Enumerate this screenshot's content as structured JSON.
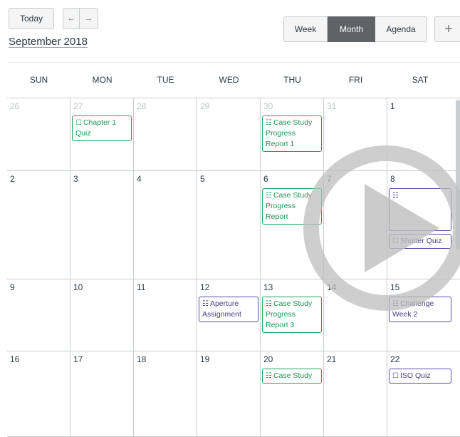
{
  "toolbar": {
    "today_label": "Today",
    "prev_icon": "←",
    "next_icon": "→",
    "title": "September 2018",
    "views": [
      "Week",
      "Month",
      "Agenda"
    ],
    "active_view": "Month",
    "add_icon": "+"
  },
  "weekdays": [
    "SUN",
    "MON",
    "TUE",
    "WED",
    "THU",
    "FRI",
    "SAT"
  ],
  "colors": {
    "green": "#1ea35c",
    "purple": "#5b4a9b",
    "active_view_bg": "#5f6368"
  },
  "weeks": [
    [
      {
        "num": "26",
        "other": true,
        "events": []
      },
      {
        "num": "27",
        "other": true,
        "events": [
          {
            "title": "Chapter 1 Quiz",
            "color": "green",
            "icon": "quiz-icon"
          }
        ]
      },
      {
        "num": "28",
        "other": true,
        "events": []
      },
      {
        "num": "29",
        "other": true,
        "events": []
      },
      {
        "num": "30",
        "other": true,
        "events": [
          {
            "title": "Case Study Progress Report 1",
            "color": "green",
            "icon": "assignment-icon"
          }
        ]
      },
      {
        "num": "31",
        "other": true,
        "events": []
      },
      {
        "num": "1",
        "other": false,
        "events": []
      }
    ],
    [
      {
        "num": "2",
        "other": false,
        "events": []
      },
      {
        "num": "3",
        "other": false,
        "events": []
      },
      {
        "num": "4",
        "other": false,
        "events": []
      },
      {
        "num": "5",
        "other": false,
        "events": []
      },
      {
        "num": "6",
        "other": false,
        "events": [
          {
            "title": "Case Study Progress Report",
            "color": "green",
            "icon": "assignment-icon"
          }
        ]
      },
      {
        "num": "7",
        "other": false,
        "events": []
      },
      {
        "num": "8",
        "other": false,
        "events": [
          {
            "title": "",
            "color": "purple",
            "icon": "assignment-icon"
          },
          {
            "title": "Shutter Quiz",
            "color": "purple",
            "icon": "quiz-icon"
          }
        ]
      }
    ],
    [
      {
        "num": "9",
        "other": false,
        "events": []
      },
      {
        "num": "10",
        "other": false,
        "events": []
      },
      {
        "num": "11",
        "other": false,
        "events": []
      },
      {
        "num": "12",
        "other": false,
        "events": [
          {
            "title": "Aperture Assignment",
            "color": "purple",
            "icon": "assignment-icon"
          }
        ]
      },
      {
        "num": "13",
        "other": false,
        "events": [
          {
            "title": "Case Study Progress Report 3",
            "color": "green",
            "icon": "assignment-icon"
          }
        ]
      },
      {
        "num": "14",
        "other": false,
        "events": []
      },
      {
        "num": "15",
        "other": false,
        "events": [
          {
            "title": "Challenge Week 2",
            "color": "purple",
            "icon": "assignment-icon"
          }
        ]
      }
    ],
    [
      {
        "num": "16",
        "other": false,
        "events": []
      },
      {
        "num": "17",
        "other": false,
        "events": []
      },
      {
        "num": "18",
        "other": false,
        "events": []
      },
      {
        "num": "19",
        "other": false,
        "events": []
      },
      {
        "num": "20",
        "other": false,
        "events": [
          {
            "title": "Case Study",
            "color": "green",
            "icon": "assignment-icon"
          }
        ]
      },
      {
        "num": "21",
        "other": false,
        "events": []
      },
      {
        "num": "22",
        "other": false,
        "events": [
          {
            "title": "ISO Quiz",
            "color": "purple",
            "icon": "quiz-icon"
          }
        ]
      }
    ]
  ]
}
